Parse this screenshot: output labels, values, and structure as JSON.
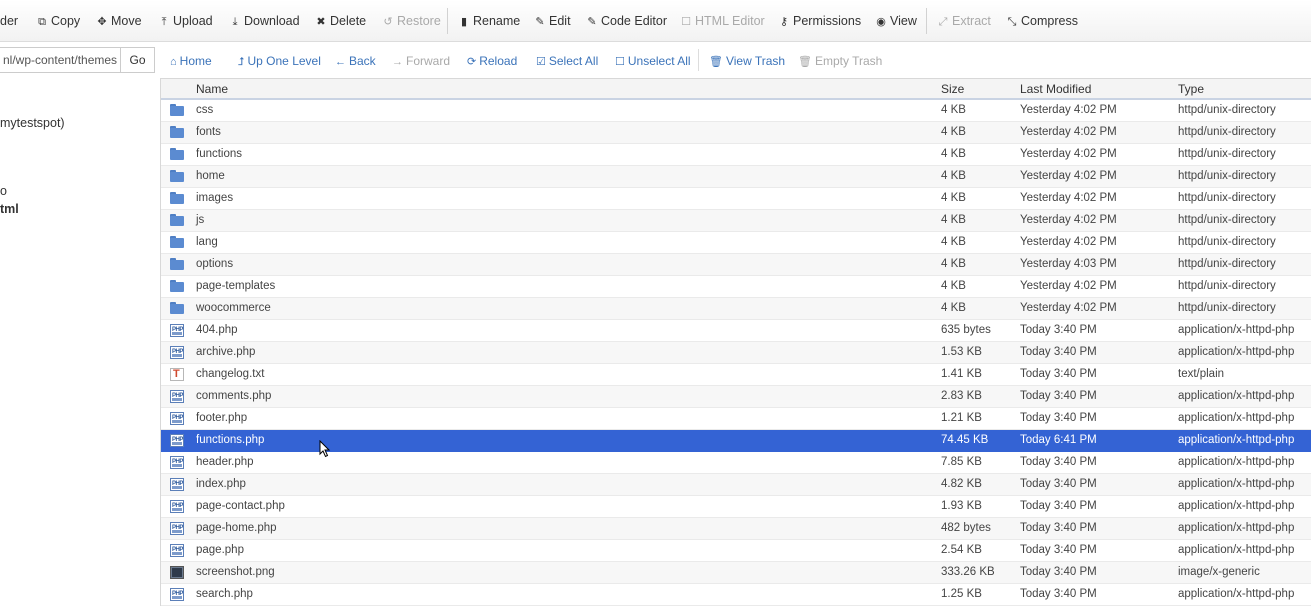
{
  "toolbar": {
    "items": [
      {
        "label": "der",
        "icon": "folder-icon",
        "disabled": false
      },
      {
        "label": "Copy",
        "icon": "copy-icon",
        "disabled": false
      },
      {
        "label": "Move",
        "icon": "move-icon",
        "disabled": false
      },
      {
        "label": "Upload",
        "icon": "upload-icon",
        "disabled": false
      },
      {
        "label": "Download",
        "icon": "download-icon",
        "disabled": false
      },
      {
        "label": "Delete",
        "icon": "delete-icon",
        "disabled": false
      },
      {
        "label": "Restore",
        "icon": "restore-icon",
        "disabled": true
      },
      {
        "label": "Rename",
        "icon": "rename-icon",
        "disabled": false
      },
      {
        "label": "Edit",
        "icon": "edit-icon",
        "disabled": false
      },
      {
        "label": "Code Editor",
        "icon": "code-editor-icon",
        "disabled": false
      },
      {
        "label": "HTML Editor",
        "icon": "html-editor-icon",
        "disabled": true
      },
      {
        "label": "Permissions",
        "icon": "permissions-icon",
        "disabled": false
      },
      {
        "label": "View",
        "icon": "view-icon",
        "disabled": false
      },
      {
        "label": "Extract",
        "icon": "extract-icon",
        "disabled": true
      },
      {
        "label": "Compress",
        "icon": "compress-icon",
        "disabled": false
      }
    ]
  },
  "pathbar": {
    "path_value": "nl/wp-content/themes",
    "go_label": "Go"
  },
  "navbar": {
    "items": [
      {
        "label": "Home",
        "icon": "home-icon",
        "disabled": false
      },
      {
        "label": "Up One Level",
        "icon": "up-level-icon",
        "disabled": false
      },
      {
        "label": "Back",
        "icon": "back-arrow-icon",
        "disabled": false
      },
      {
        "label": "Forward",
        "icon": "forward-arrow-icon",
        "disabled": true
      },
      {
        "label": "Reload",
        "icon": "reload-icon",
        "disabled": false
      },
      {
        "label": "Select All",
        "icon": "select-all-icon",
        "disabled": false
      },
      {
        "label": "Unselect All",
        "icon": "unselect-all-icon",
        "disabled": false
      },
      {
        "label": "View Trash",
        "icon": "trash-icon",
        "disabled": false
      },
      {
        "label": "Empty Trash",
        "icon": "empty-trash-icon",
        "disabled": true
      }
    ]
  },
  "tree": {
    "items": [
      {
        "label": "mytestspot)",
        "bold": false
      },
      {
        "label": "o",
        "bold": false
      },
      {
        "label": "tml",
        "bold": true
      }
    ]
  },
  "table": {
    "headers": {
      "name": "Name",
      "size": "Size",
      "modified": "Last Modified",
      "type": "Type"
    },
    "rows": [
      {
        "icon": "folder",
        "name": "css",
        "size": "4 KB",
        "modified": "Yesterday 4:02 PM",
        "type": "httpd/unix-directory"
      },
      {
        "icon": "folder",
        "name": "fonts",
        "size": "4 KB",
        "modified": "Yesterday 4:02 PM",
        "type": "httpd/unix-directory"
      },
      {
        "icon": "folder",
        "name": "functions",
        "size": "4 KB",
        "modified": "Yesterday 4:02 PM",
        "type": "httpd/unix-directory"
      },
      {
        "icon": "folder",
        "name": "home",
        "size": "4 KB",
        "modified": "Yesterday 4:02 PM",
        "type": "httpd/unix-directory"
      },
      {
        "icon": "folder",
        "name": "images",
        "size": "4 KB",
        "modified": "Yesterday 4:02 PM",
        "type": "httpd/unix-directory"
      },
      {
        "icon": "folder",
        "name": "js",
        "size": "4 KB",
        "modified": "Yesterday 4:02 PM",
        "type": "httpd/unix-directory"
      },
      {
        "icon": "folder",
        "name": "lang",
        "size": "4 KB",
        "modified": "Yesterday 4:02 PM",
        "type": "httpd/unix-directory"
      },
      {
        "icon": "folder",
        "name": "options",
        "size": "4 KB",
        "modified": "Yesterday 4:03 PM",
        "type": "httpd/unix-directory"
      },
      {
        "icon": "folder",
        "name": "page-templates",
        "size": "4 KB",
        "modified": "Yesterday 4:02 PM",
        "type": "httpd/unix-directory"
      },
      {
        "icon": "folder",
        "name": "woocommerce",
        "size": "4 KB",
        "modified": "Yesterday 4:02 PM",
        "type": "httpd/unix-directory"
      },
      {
        "icon": "php",
        "name": "404.php",
        "size": "635 bytes",
        "modified": "Today 3:40 PM",
        "type": "application/x-httpd-php"
      },
      {
        "icon": "php",
        "name": "archive.php",
        "size": "1.53 KB",
        "modified": "Today 3:40 PM",
        "type": "application/x-httpd-php"
      },
      {
        "icon": "txt",
        "name": "changelog.txt",
        "size": "1.41 KB",
        "modified": "Today 3:40 PM",
        "type": "text/plain"
      },
      {
        "icon": "php",
        "name": "comments.php",
        "size": "2.83 KB",
        "modified": "Today 3:40 PM",
        "type": "application/x-httpd-php"
      },
      {
        "icon": "php",
        "name": "footer.php",
        "size": "1.21 KB",
        "modified": "Today 3:40 PM",
        "type": "application/x-httpd-php"
      },
      {
        "icon": "php",
        "name": "functions.php",
        "size": "74.45 KB",
        "modified": "Today 6:41 PM",
        "type": "application/x-httpd-php",
        "selected": true
      },
      {
        "icon": "php",
        "name": "header.php",
        "size": "7.85 KB",
        "modified": "Today 3:40 PM",
        "type": "application/x-httpd-php"
      },
      {
        "icon": "php",
        "name": "index.php",
        "size": "4.82 KB",
        "modified": "Today 3:40 PM",
        "type": "application/x-httpd-php"
      },
      {
        "icon": "php",
        "name": "page-contact.php",
        "size": "1.93 KB",
        "modified": "Today 3:40 PM",
        "type": "application/x-httpd-php"
      },
      {
        "icon": "php",
        "name": "page-home.php",
        "size": "482 bytes",
        "modified": "Today 3:40 PM",
        "type": "application/x-httpd-php"
      },
      {
        "icon": "php",
        "name": "page.php",
        "size": "2.54 KB",
        "modified": "Today 3:40 PM",
        "type": "application/x-httpd-php"
      },
      {
        "icon": "img",
        "name": "screenshot.png",
        "size": "333.26 KB",
        "modified": "Today 3:40 PM",
        "type": "image/x-generic"
      },
      {
        "icon": "php",
        "name": "search.php",
        "size": "1.25 KB",
        "modified": "Today 3:40 PM",
        "type": "application/x-httpd-php"
      }
    ]
  },
  "colors": {
    "link": "#3b73b9",
    "selected_row": "#3463d4",
    "disabled": "#a9a9a9"
  }
}
